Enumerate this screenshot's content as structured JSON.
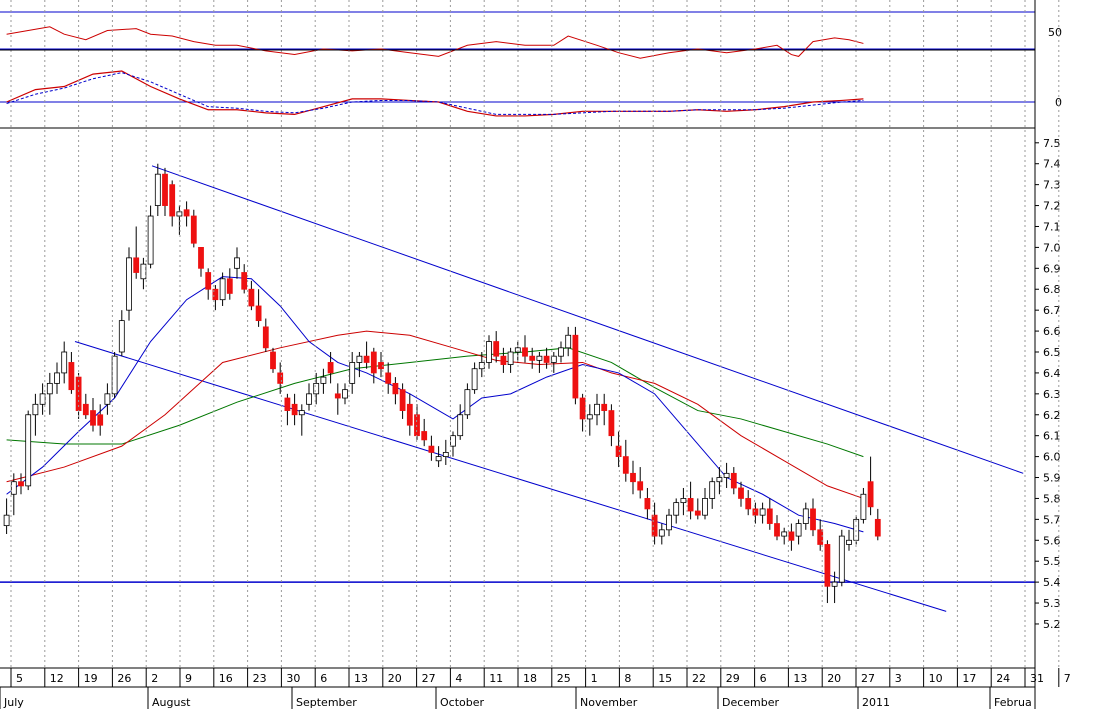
{
  "chart_data": {
    "type": "candlestick",
    "colors": {
      "up": "#ffffff",
      "down": "#ee1111",
      "doji": "#000000",
      "channel": "#0000cc",
      "support": "#0000cc",
      "ma_short": "#0000cc",
      "ma_mid": "#cc0000",
      "ma_long": "#007700",
      "grid": "#9a9a9a"
    },
    "price_axis": {
      "ticks": [
        "7.5",
        "7.4",
        "7.3",
        "7.2",
        "7.1",
        "7.0",
        "6.9",
        "6.8",
        "6.7",
        "6.6",
        "6.5",
        "6.4",
        "6.3",
        "6.2",
        "6.1",
        "6.0",
        "5.9",
        "5.8",
        "5.7",
        "5.6",
        "5.5",
        "5.4",
        "5.3",
        "5.2"
      ],
      "ylim": [
        5.15,
        7.55
      ]
    },
    "indicator_axis": {
      "top_label": "50",
      "mid_label": "0"
    },
    "day_ticks": [
      "5",
      "12",
      "19",
      "26",
      "2",
      "9",
      "16",
      "23",
      "30",
      "6",
      "13",
      "20",
      "27",
      "4",
      "11",
      "18",
      "25",
      "1",
      "8",
      "15",
      "22",
      "29",
      "6",
      "13",
      "20",
      "27",
      "3",
      "10",
      "17",
      "24",
      "31",
      "7"
    ],
    "month_labels": [
      "July",
      "August",
      "September",
      "October",
      "November",
      "December",
      "2011",
      "Februa"
    ],
    "channel": {
      "upper_line": [
        [
          0,
          7.39
        ],
        [
          121,
          5.92
        ]
      ],
      "lower_line": [
        [
          0,
          6.55
        ],
        [
          121,
          5.26
        ]
      ]
    },
    "support_level": 5.4,
    "candles": [
      [
        5.67,
        5.8,
        5.63,
        5.72
      ],
      [
        5.82,
        5.92,
        5.72,
        5.88
      ],
      [
        5.88,
        5.92,
        5.82,
        5.86
      ],
      [
        5.86,
        6.22,
        5.84,
        6.2
      ],
      [
        6.2,
        6.3,
        6.1,
        6.25
      ],
      [
        6.25,
        6.35,
        6.2,
        6.3
      ],
      [
        6.3,
        6.4,
        6.2,
        6.35
      ],
      [
        6.35,
        6.45,
        6.3,
        6.4
      ],
      [
        6.4,
        6.55,
        6.35,
        6.5
      ],
      [
        6.45,
        6.5,
        6.3,
        6.32
      ],
      [
        6.38,
        6.4,
        6.18,
        6.22
      ],
      [
        6.25,
        6.3,
        6.18,
        6.2
      ],
      [
        6.22,
        6.28,
        6.12,
        6.15
      ],
      [
        6.2,
        6.25,
        6.1,
        6.15
      ],
      [
        6.25,
        6.35,
        6.2,
        6.3
      ],
      [
        6.3,
        6.5,
        6.28,
        6.48
      ],
      [
        6.5,
        6.7,
        6.48,
        6.65
      ],
      [
        6.7,
        7.0,
        6.65,
        6.95
      ],
      [
        6.95,
        7.1,
        6.85,
        6.88
      ],
      [
        6.85,
        6.95,
        6.8,
        6.92
      ],
      [
        6.92,
        7.2,
        6.9,
        7.15
      ],
      [
        7.2,
        7.4,
        7.15,
        7.35
      ],
      [
        7.35,
        7.38,
        7.15,
        7.2
      ],
      [
        7.3,
        7.32,
        7.1,
        7.15
      ],
      [
        7.15,
        7.2,
        7.06,
        7.17
      ],
      [
        7.18,
        7.22,
        7.1,
        7.15
      ],
      [
        7.15,
        7.18,
        7.0,
        7.02
      ],
      [
        7.0,
        7.0,
        6.86,
        6.9
      ],
      [
        6.88,
        6.9,
        6.75,
        6.8
      ],
      [
        6.8,
        6.82,
        6.7,
        6.75
      ],
      [
        6.75,
        6.88,
        6.72,
        6.85
      ],
      [
        6.85,
        6.9,
        6.75,
        6.78
      ],
      [
        6.9,
        7.0,
        6.85,
        6.95
      ],
      [
        6.88,
        6.92,
        6.78,
        6.8
      ],
      [
        6.8,
        6.84,
        6.7,
        6.72
      ],
      [
        6.72,
        6.8,
        6.62,
        6.65
      ],
      [
        6.62,
        6.66,
        6.5,
        6.52
      ],
      [
        6.5,
        6.52,
        6.4,
        6.42
      ],
      [
        6.4,
        6.45,
        6.3,
        6.35
      ],
      [
        6.28,
        6.3,
        6.15,
        6.22
      ],
      [
        6.25,
        6.3,
        6.15,
        6.2
      ],
      [
        6.2,
        6.25,
        6.1,
        6.22
      ],
      [
        6.25,
        6.35,
        6.22,
        6.3
      ],
      [
        6.3,
        6.4,
        6.25,
        6.35
      ],
      [
        6.35,
        6.42,
        6.3,
        6.38
      ],
      [
        6.45,
        6.5,
        6.35,
        6.4
      ],
      [
        6.3,
        6.35,
        6.2,
        6.28
      ],
      [
        6.28,
        6.35,
        6.25,
        6.32
      ],
      [
        6.35,
        6.5,
        6.3,
        6.45
      ],
      [
        6.45,
        6.5,
        6.38,
        6.48
      ],
      [
        6.48,
        6.55,
        6.42,
        6.45
      ],
      [
        6.5,
        6.52,
        6.35,
        6.4
      ],
      [
        6.45,
        6.5,
        6.38,
        6.42
      ],
      [
        6.4,
        6.45,
        6.3,
        6.35
      ],
      [
        6.35,
        6.38,
        6.25,
        6.3
      ],
      [
        6.32,
        6.35,
        6.18,
        6.22
      ],
      [
        6.25,
        6.3,
        6.1,
        6.15
      ],
      [
        6.2,
        6.25,
        6.08,
        6.1
      ],
      [
        6.12,
        6.18,
        6.05,
        6.08
      ],
      [
        6.05,
        6.1,
        5.98,
        6.02
      ],
      [
        5.98,
        6.05,
        5.95,
        6.0
      ],
      [
        6.0,
        6.08,
        5.96,
        6.02
      ],
      [
        6.05,
        6.12,
        6.0,
        6.1
      ],
      [
        6.1,
        6.25,
        6.08,
        6.2
      ],
      [
        6.2,
        6.35,
        6.18,
        6.32
      ],
      [
        6.32,
        6.45,
        6.3,
        6.42
      ],
      [
        6.42,
        6.5,
        6.38,
        6.45
      ],
      [
        6.45,
        6.58,
        6.42,
        6.55
      ],
      [
        6.55,
        6.6,
        6.45,
        6.48
      ],
      [
        6.48,
        6.52,
        6.4,
        6.44
      ],
      [
        6.44,
        6.52,
        6.4,
        6.5
      ],
      [
        6.5,
        6.55,
        6.45,
        6.52
      ],
      [
        6.52,
        6.58,
        6.45,
        6.48
      ],
      [
        6.48,
        6.52,
        6.42,
        6.46
      ],
      [
        6.46,
        6.5,
        6.4,
        6.48
      ],
      [
        6.48,
        6.52,
        6.42,
        6.45
      ],
      [
        6.45,
        6.5,
        6.4,
        6.48
      ],
      [
        6.48,
        6.55,
        6.45,
        6.52
      ],
      [
        6.52,
        6.62,
        6.48,
        6.58
      ],
      [
        6.58,
        6.62,
        6.25,
        6.28
      ],
      [
        6.28,
        6.3,
        6.12,
        6.18
      ],
      [
        6.18,
        6.25,
        6.1,
        6.2
      ],
      [
        6.2,
        6.3,
        6.15,
        6.25
      ],
      [
        6.25,
        6.3,
        6.15,
        6.22
      ],
      [
        6.22,
        6.25,
        6.05,
        6.1
      ],
      [
        6.05,
        6.12,
        5.95,
        6.0
      ],
      [
        6.0,
        6.08,
        5.88,
        5.92
      ],
      [
        5.92,
        5.98,
        5.82,
        5.88
      ],
      [
        5.88,
        5.95,
        5.8,
        5.84
      ],
      [
        5.8,
        5.85,
        5.7,
        5.75
      ],
      [
        5.72,
        5.78,
        5.58,
        5.62
      ],
      [
        5.62,
        5.68,
        5.58,
        5.65
      ],
      [
        5.65,
        5.75,
        5.62,
        5.72
      ],
      [
        5.72,
        5.8,
        5.68,
        5.78
      ],
      [
        5.78,
        5.85,
        5.72,
        5.8
      ],
      [
        5.8,
        5.88,
        5.7,
        5.74
      ],
      [
        5.74,
        5.8,
        5.7,
        5.72
      ],
      [
        5.72,
        5.85,
        5.7,
        5.8
      ],
      [
        5.8,
        5.9,
        5.75,
        5.88
      ],
      [
        5.88,
        5.95,
        5.82,
        5.9
      ],
      [
        5.9,
        5.97,
        5.85,
        5.92
      ],
      [
        5.92,
        5.95,
        5.82,
        5.85
      ],
      [
        5.85,
        5.88,
        5.76,
        5.8
      ],
      [
        5.8,
        5.84,
        5.72,
        5.75
      ],
      [
        5.75,
        5.78,
        5.68,
        5.72
      ],
      [
        5.72,
        5.78,
        5.68,
        5.75
      ],
      [
        5.75,
        5.8,
        5.65,
        5.68
      ],
      [
        5.68,
        5.72,
        5.6,
        5.62
      ],
      [
        5.62,
        5.66,
        5.58,
        5.64
      ],
      [
        5.64,
        5.68,
        5.55,
        5.6
      ],
      [
        5.62,
        5.7,
        5.58,
        5.68
      ],
      [
        5.68,
        5.78,
        5.65,
        5.75
      ],
      [
        5.75,
        5.8,
        5.62,
        5.65
      ],
      [
        5.65,
        5.7,
        5.55,
        5.58
      ],
      [
        5.58,
        5.6,
        5.3,
        5.38
      ],
      [
        5.38,
        5.45,
        5.3,
        5.4
      ],
      [
        5.4,
        5.65,
        5.38,
        5.62
      ],
      [
        5.58,
        5.65,
        5.55,
        5.6
      ],
      [
        5.6,
        5.72,
        5.58,
        5.7
      ],
      [
        5.7,
        5.85,
        5.68,
        5.82
      ],
      [
        5.88,
        6.0,
        5.72,
        5.76
      ],
      [
        5.7,
        5.75,
        5.6,
        5.62
      ]
    ],
    "ma_short": [
      [
        0,
        5.82
      ],
      [
        5,
        5.95
      ],
      [
        10,
        6.12
      ],
      [
        15,
        6.28
      ],
      [
        20,
        6.55
      ],
      [
        25,
        6.75
      ],
      [
        30,
        6.86
      ],
      [
        34,
        6.85
      ],
      [
        38,
        6.72
      ],
      [
        42,
        6.55
      ],
      [
        46,
        6.45
      ],
      [
        50,
        6.4
      ],
      [
        56,
        6.3
      ],
      [
        62,
        6.18
      ],
      [
        66,
        6.28
      ],
      [
        70,
        6.3
      ],
      [
        75,
        6.38
      ],
      [
        80,
        6.44
      ],
      [
        85,
        6.4
      ],
      [
        90,
        6.3
      ],
      [
        95,
        6.1
      ],
      [
        100,
        5.9
      ],
      [
        105,
        5.82
      ],
      [
        110,
        5.72
      ],
      [
        115,
        5.68
      ],
      [
        119,
        5.64
      ]
    ],
    "ma_mid": [
      [
        0,
        5.88
      ],
      [
        8,
        5.95
      ],
      [
        16,
        6.05
      ],
      [
        22,
        6.2
      ],
      [
        30,
        6.45
      ],
      [
        38,
        6.52
      ],
      [
        46,
        6.58
      ],
      [
        50,
        6.6
      ],
      [
        56,
        6.58
      ],
      [
        62,
        6.52
      ],
      [
        68,
        6.46
      ],
      [
        74,
        6.44
      ],
      [
        80,
        6.45
      ],
      [
        84,
        6.4
      ],
      [
        90,
        6.35
      ],
      [
        96,
        6.25
      ],
      [
        102,
        6.1
      ],
      [
        108,
        5.98
      ],
      [
        114,
        5.86
      ],
      [
        119,
        5.8
      ]
    ],
    "ma_long": [
      [
        0,
        6.08
      ],
      [
        8,
        6.06
      ],
      [
        16,
        6.06
      ],
      [
        24,
        6.15
      ],
      [
        32,
        6.26
      ],
      [
        40,
        6.35
      ],
      [
        48,
        6.42
      ],
      [
        56,
        6.45
      ],
      [
        64,
        6.48
      ],
      [
        72,
        6.5
      ],
      [
        78,
        6.52
      ],
      [
        84,
        6.45
      ],
      [
        90,
        6.33
      ],
      [
        96,
        6.22
      ],
      [
        102,
        6.18
      ],
      [
        108,
        6.12
      ],
      [
        114,
        6.06
      ],
      [
        119,
        6.0
      ]
    ],
    "rsi": [
      [
        0,
        58
      ],
      [
        3,
        60
      ],
      [
        6,
        62
      ],
      [
        8,
        58
      ],
      [
        11,
        55
      ],
      [
        14,
        60
      ],
      [
        18,
        61
      ],
      [
        20,
        58
      ],
      [
        23,
        57
      ],
      [
        26,
        54
      ],
      [
        29,
        52
      ],
      [
        32,
        52
      ],
      [
        36,
        49
      ],
      [
        40,
        47
      ],
      [
        44,
        50
      ],
      [
        48,
        49
      ],
      [
        52,
        50
      ],
      [
        56,
        48
      ],
      [
        60,
        46
      ],
      [
        64,
        52
      ],
      [
        68,
        54
      ],
      [
        72,
        52
      ],
      [
        76,
        52
      ],
      [
        78,
        57
      ],
      [
        82,
        52
      ],
      [
        85,
        48
      ],
      [
        88,
        45
      ],
      [
        92,
        48
      ],
      [
        96,
        50
      ],
      [
        100,
        48
      ],
      [
        104,
        50
      ],
      [
        107,
        52
      ],
      [
        109,
        47
      ],
      [
        110,
        46
      ],
      [
        112,
        54
      ],
      [
        115,
        56
      ],
      [
        117,
        55
      ],
      [
        119,
        53
      ]
    ],
    "macd": [
      [
        0,
        0
      ],
      [
        4,
        8
      ],
      [
        8,
        10
      ],
      [
        12,
        18
      ],
      [
        16,
        20
      ],
      [
        20,
        10
      ],
      [
        24,
        2
      ],
      [
        28,
        -5
      ],
      [
        32,
        -5
      ],
      [
        36,
        -7
      ],
      [
        40,
        -8
      ],
      [
        44,
        -3
      ],
      [
        48,
        2
      ],
      [
        52,
        2
      ],
      [
        56,
        1
      ],
      [
        60,
        0
      ],
      [
        64,
        -6
      ],
      [
        68,
        -9
      ],
      [
        72,
        -9
      ],
      [
        76,
        -8
      ],
      [
        80,
        -6
      ],
      [
        84,
        -6
      ],
      [
        88,
        -6
      ],
      [
        92,
        -6
      ],
      [
        96,
        -5
      ],
      [
        100,
        -6
      ],
      [
        104,
        -5
      ],
      [
        108,
        -3
      ],
      [
        112,
        0
      ],
      [
        116,
        1
      ],
      [
        119,
        2
      ]
    ],
    "macd_signal": [
      [
        0,
        -1
      ],
      [
        4,
        5
      ],
      [
        8,
        9
      ],
      [
        12,
        15
      ],
      [
        16,
        19
      ],
      [
        20,
        13
      ],
      [
        24,
        5
      ],
      [
        28,
        -3
      ],
      [
        32,
        -4
      ],
      [
        36,
        -6
      ],
      [
        40,
        -7
      ],
      [
        44,
        -4
      ],
      [
        48,
        0
      ],
      [
        52,
        1
      ],
      [
        56,
        1
      ],
      [
        60,
        0
      ],
      [
        64,
        -4
      ],
      [
        68,
        -8
      ],
      [
        72,
        -8
      ],
      [
        76,
        -8
      ],
      [
        80,
        -7
      ],
      [
        84,
        -6
      ],
      [
        88,
        -6
      ],
      [
        92,
        -6
      ],
      [
        96,
        -5
      ],
      [
        100,
        -5
      ],
      [
        104,
        -5
      ],
      [
        108,
        -4
      ],
      [
        112,
        -2
      ],
      [
        116,
        0
      ],
      [
        119,
        1
      ]
    ]
  }
}
